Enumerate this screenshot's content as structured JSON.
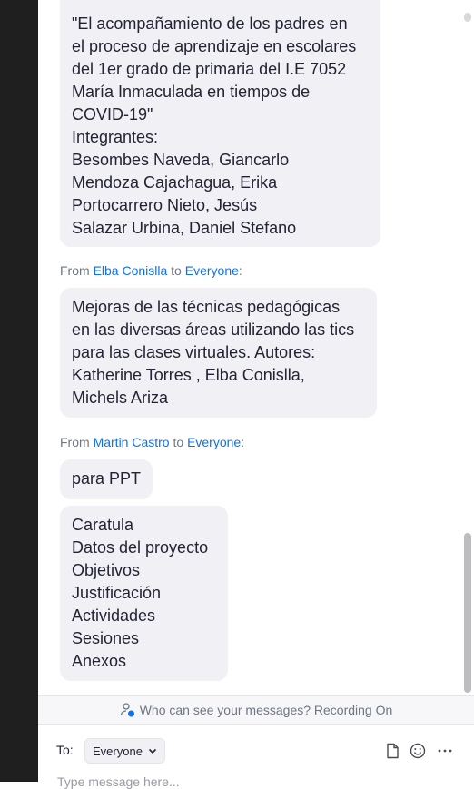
{
  "messages": [
    {
      "lines": [
        "\"El acompañamiento de los padres en",
        "el proceso de aprendizaje en escolares",
        "del 1er grado de primaria del I.E 7052",
        "María Inmaculada en tiempos de",
        "COVID-19\"",
        "Integrantes:",
        "Besombes Naveda, Giancarlo",
        "Mendoza Cajachagua, Erika",
        "Portocarrero Nieto, Jesús",
        "Salazar Urbina, Daniel Stefano"
      ]
    },
    {
      "header": {
        "from_word": "From",
        "sender": "Elba Conislla",
        "to_word": "to",
        "recipient": "Everyone",
        "colon": ":"
      },
      "lines": [
        "Mejoras de las técnicas pedagógicas",
        "en las diversas áreas utilizando las tics",
        "para las clases virtuales. Autores:",
        "Katherine Torres , Elba Conislla,",
        "Michels Ariza"
      ]
    },
    {
      "header": {
        "from_word": "From",
        "sender": "Martin Castro",
        "to_word": "to",
        "recipient": "Everyone",
        "colon": ":"
      },
      "lines": [
        "para PPT"
      ]
    },
    {
      "lines": [
        "Caratula",
        "Datos del proyecto",
        "Objetivos",
        "Justificación",
        "Actividades",
        "Sesiones",
        "Anexos"
      ]
    }
  ],
  "notice": {
    "text": "Who can see your messages? Recording On",
    "icon": "people-lock-icon"
  },
  "composer": {
    "to_label": "To:",
    "recipient_value": "Everyone",
    "placeholder": "Type message here...",
    "tools": [
      "file-icon",
      "emoji-icon",
      "more-icon"
    ]
  },
  "colors": {
    "link": "#0e71eb",
    "bubble": "#f0f0f5",
    "text": "#232333",
    "meta": "#6e7680"
  }
}
